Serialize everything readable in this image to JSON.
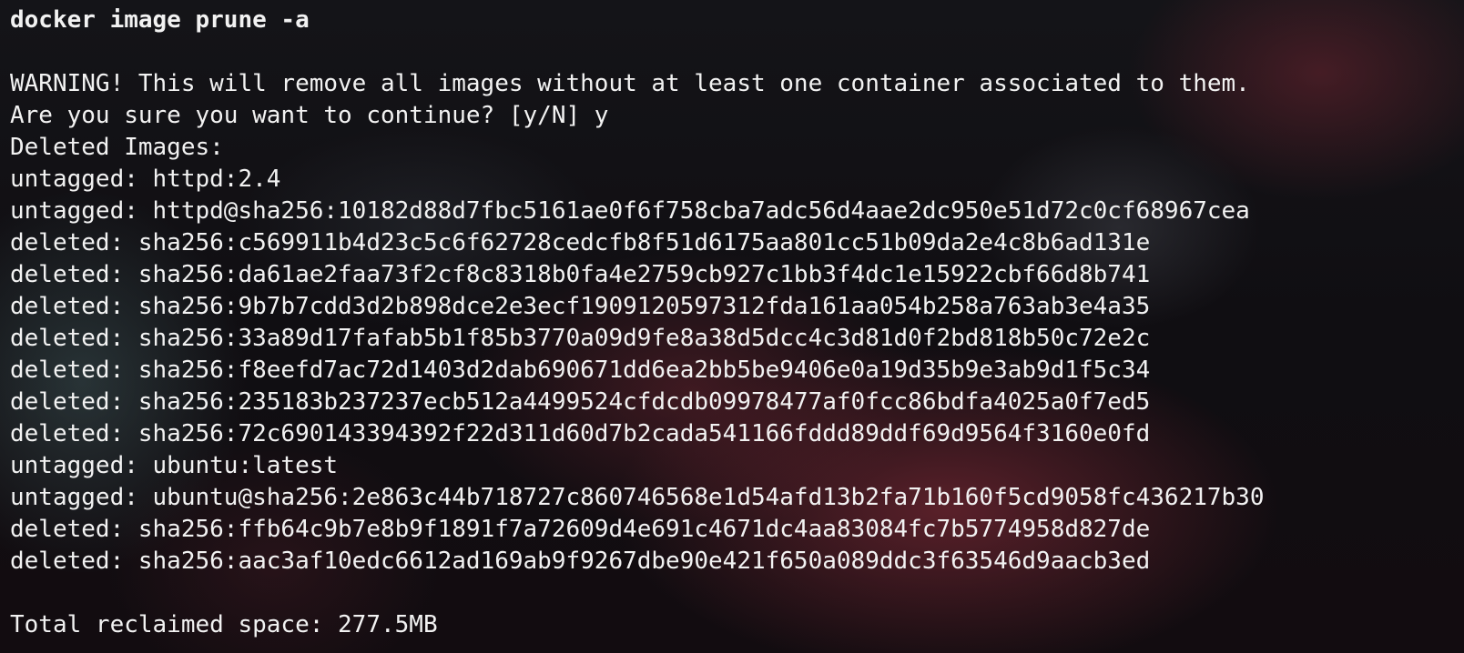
{
  "terminal": {
    "command": "docker image prune -a",
    "lines": [
      "",
      "WARNING! This will remove all images without at least one container associated to them.",
      "Are you sure you want to continue? [y/N] y",
      "Deleted Images:",
      "untagged: httpd:2.4",
      "untagged: httpd@sha256:10182d88d7fbc5161ae0f6f758cba7adc56d4aae2dc950e51d72c0cf68967cea",
      "deleted: sha256:c569911b4d23c5c6f62728cedcfb8f51d6175aa801cc51b09da2e4c8b6ad131e",
      "deleted: sha256:da61ae2faa73f2cf8c8318b0fa4e2759cb927c1bb3f4dc1e15922cbf66d8b741",
      "deleted: sha256:9b7b7cdd3d2b898dce2e3ecf1909120597312fda161aa054b258a763ab3e4a35",
      "deleted: sha256:33a89d17fafab5b1f85b3770a09d9fe8a38d5dcc4c3d81d0f2bd818b50c72e2c",
      "deleted: sha256:f8eefd7ac72d1403d2dab690671dd6ea2bb5be9406e0a19d35b9e3ab9d1f5c34",
      "deleted: sha256:235183b237237ecb512a4499524cfdcdb09978477af0fcc86bdfa4025a0f7ed5",
      "deleted: sha256:72c690143394392f22d311d60d7b2cada541166fddd89ddf69d9564f3160e0fd",
      "untagged: ubuntu:latest",
      "untagged: ubuntu@sha256:2e863c44b718727c860746568e1d54afd13b2fa71b160f5cd9058fc436217b30",
      "deleted: sha256:ffb64c9b7e8b9f1891f7a72609d4e691c4671dc4aa83084fc7b5774958d827de",
      "deleted: sha256:aac3af10edc6612ad169ab9f9267dbe90e421f650a089ddc3f63546d9aacb3ed",
      "",
      "Total reclaimed space: 277.5MB"
    ]
  },
  "colors": {
    "text": "#f2f2f2",
    "background": "#121014",
    "glow_red": "#96303e",
    "glow_teal": "#3c5254"
  }
}
